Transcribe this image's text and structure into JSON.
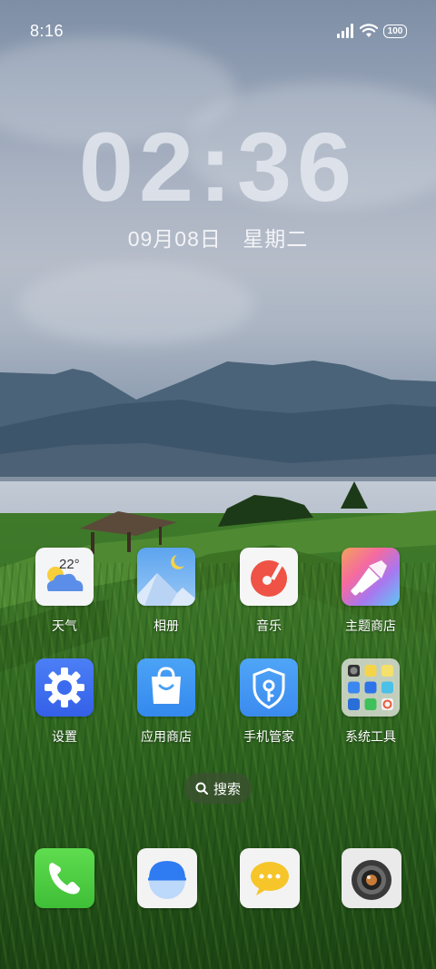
{
  "status_bar": {
    "time": "8:16",
    "battery": "100"
  },
  "lock_clock": {
    "time": "02:36",
    "date": "09月08日",
    "weekday": "星期二"
  },
  "apps": [
    {
      "label": "天气",
      "icon": "weather-icon",
      "temp": "22°"
    },
    {
      "label": "相册",
      "icon": "gallery-icon"
    },
    {
      "label": "音乐",
      "icon": "music-icon"
    },
    {
      "label": "主题商店",
      "icon": "theme-store-icon"
    },
    {
      "label": "设置",
      "icon": "settings-gear-icon"
    },
    {
      "label": "应用商店",
      "icon": "app-store-bag-icon"
    },
    {
      "label": "手机管家",
      "icon": "phone-manager-shield-icon"
    },
    {
      "label": "系统工具",
      "icon": "system-tools-folder-icon"
    }
  ],
  "search": {
    "label": "搜索"
  },
  "dock": [
    {
      "icon": "phone-icon"
    },
    {
      "icon": "browser-icon"
    },
    {
      "icon": "messages-icon"
    },
    {
      "icon": "camera-icon"
    }
  ],
  "colors": {
    "phone_green": "#4cd34a",
    "settings_blue": "#3f6ff3",
    "music_red": "#ee5345",
    "messages_yellow": "#f5c52a"
  }
}
